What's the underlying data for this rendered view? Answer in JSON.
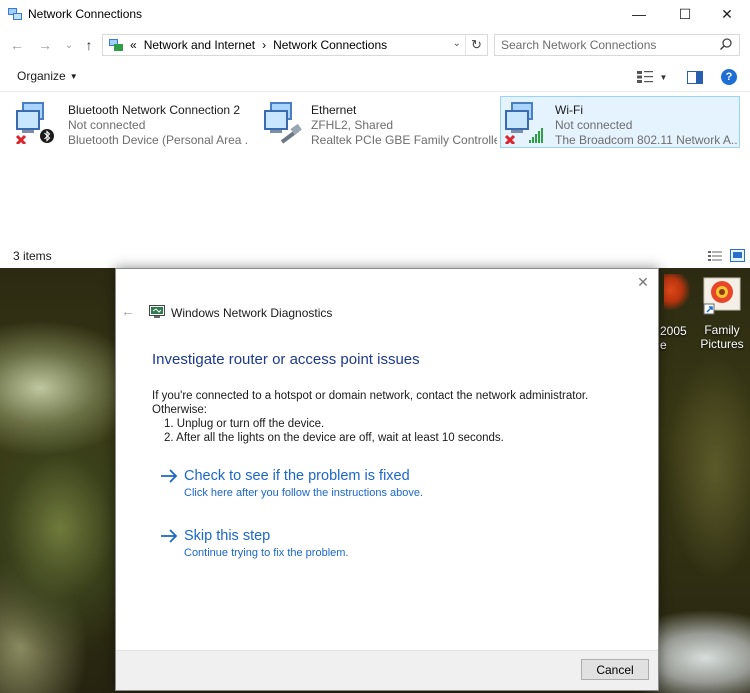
{
  "window": {
    "title": "Network Connections",
    "controls": {
      "minimize": "—",
      "maximize": "☐",
      "close": "✕"
    }
  },
  "nav": {
    "back": "←",
    "forward": "→",
    "recent": "⌄",
    "up": "↑",
    "breadcrumb": {
      "overflow": "«",
      "items": [
        "Network and Internet",
        "Network Connections"
      ],
      "separator": "›"
    },
    "refresh": "↻",
    "dropdown": "⌄"
  },
  "search": {
    "placeholder": "Search Network Connections"
  },
  "commandbar": {
    "organize_label": "Organize"
  },
  "connections": [
    {
      "name": "Bluetooth Network Connection 2",
      "status": "Not connected",
      "device": "Bluetooth Device (Personal Area ...",
      "badge": "bluetooth-icon",
      "error": true,
      "selected": false
    },
    {
      "name": "Ethernet",
      "status": "ZFHL2, Shared",
      "device": "Realtek PCIe GBE Family Controller",
      "badge": "ethernet-cable-icon",
      "error": false,
      "selected": false
    },
    {
      "name": "Wi-Fi",
      "status": "Not connected",
      "device": "The Broadcom 802.11 Network A...",
      "badge": "wifi-signal-icon",
      "error": true,
      "selected": true
    }
  ],
  "statusbar": {
    "count": "3 items"
  },
  "desktop_icons": [
    {
      "label_line1": "2005",
      "label_line2": "e"
    },
    {
      "label_line1": "Family",
      "label_line2": "Pictures"
    }
  ],
  "dialog": {
    "title": "Windows Network Diagnostics",
    "heading": "Investigate router or access point issues",
    "body_line1": "If you're connected to a hotspot or domain network, contact the network administrator.",
    "body_line2": "Otherwise:",
    "steps": [
      "1.  Unplug or turn off the device.",
      "2.  After all the lights on the device are off, wait at least 10 seconds."
    ],
    "options": [
      {
        "title": "Check to see if the problem is fixed",
        "subtitle": "Click here after you follow the instructions above."
      },
      {
        "title": "Skip this step",
        "subtitle": "Continue trying to fix the problem."
      }
    ],
    "close": "✕",
    "back": "←",
    "cancel_label": "Cancel"
  },
  "colors": {
    "link_blue": "#1a67c8",
    "heading_blue": "#1c3a8f",
    "selection_bg": "#e5f3ff",
    "selection_border": "#99d1ff",
    "error_red": "#d9262d"
  }
}
